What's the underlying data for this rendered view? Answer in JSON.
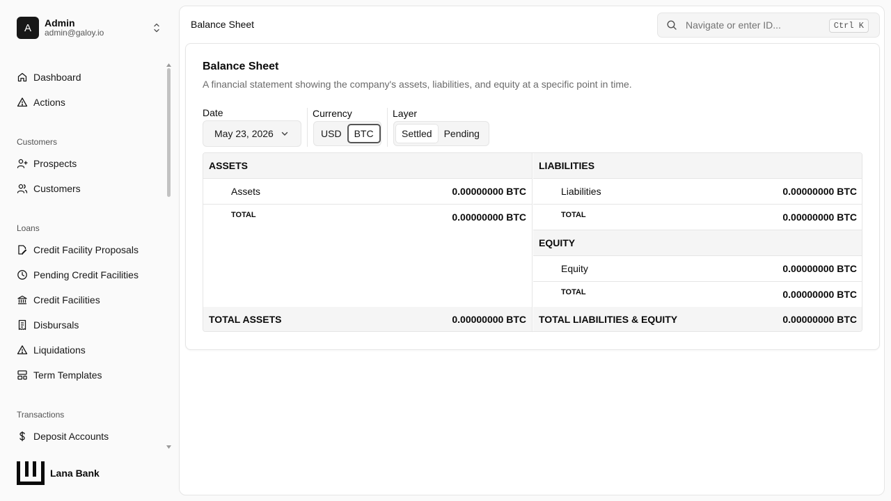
{
  "user": {
    "initial": "A",
    "name": "Admin",
    "email": "admin@galoy.io"
  },
  "nav": {
    "dashboard": "Dashboard",
    "actions": "Actions",
    "customers_group": "Customers",
    "prospects": "Prospects",
    "customers": "Customers",
    "loans_group": "Loans",
    "credit_facility_proposals": "Credit Facility Proposals",
    "pending_credit_facilities": "Pending Credit Facilities",
    "credit_facilities": "Credit Facilities",
    "disbursals": "Disbursals",
    "liquidations": "Liquidations",
    "term_templates": "Term Templates",
    "transactions_group": "Transactions",
    "deposit_accounts": "Deposit Accounts"
  },
  "brand": {
    "name": "Lana Bank"
  },
  "header": {
    "breadcrumb": "Balance Sheet",
    "search_placeholder": "Navigate or enter ID...",
    "shortcut": "Ctrl K"
  },
  "card": {
    "title": "Balance Sheet",
    "description": "A financial statement showing the company's assets, liabilities, and equity at a specific point in time."
  },
  "controls": {
    "date_label": "Date",
    "date_value": "May 23, 2026",
    "currency_label": "Currency",
    "currency_options": [
      "USD",
      "BTC"
    ],
    "currency_selected": "BTC",
    "layer_label": "Layer",
    "layer_options": [
      "Settled",
      "Pending"
    ],
    "layer_selected": "Settled"
  },
  "sheet": {
    "assets": {
      "header": "ASSETS",
      "item_name": "Assets",
      "item_amount": "0.00000000 BTC",
      "total_label": "TOTAL",
      "total_amount": "0.00000000 BTC",
      "grand_label": "TOTAL ASSETS",
      "grand_amount": "0.00000000 BTC"
    },
    "liabilities": {
      "header": "LIABILITIES",
      "item_name": "Liabilities",
      "item_amount": "0.00000000 BTC",
      "total_label": "TOTAL",
      "total_amount": "0.00000000 BTC"
    },
    "equity": {
      "header": "EQUITY",
      "item_name": "Equity",
      "item_amount": "0.00000000 BTC",
      "total_label": "TOTAL",
      "total_amount": "0.00000000 BTC",
      "grand_label": "TOTAL LIABILITIES & EQUITY",
      "grand_amount": "0.00000000 BTC"
    }
  }
}
